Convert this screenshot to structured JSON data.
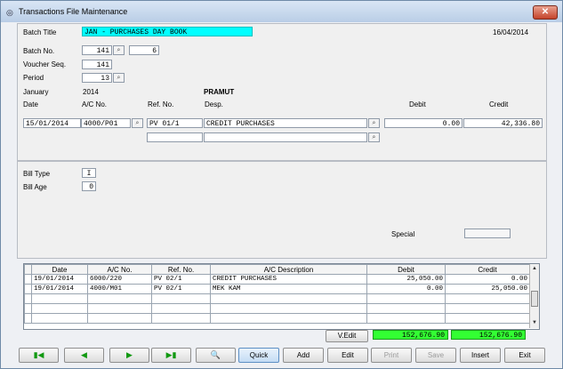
{
  "window": {
    "title": "Transactions File Maintenance",
    "close_label": "✕"
  },
  "header": {
    "batch_title_label": "Batch Title",
    "batch_title_value": "JAN - PURCHASES DAY BOOK",
    "date": "16/04/2014",
    "batch_no_label": "Batch No.",
    "batch_no_value": "141",
    "batch_no_extra": "6",
    "voucher_seq_label": "Voucher Seq.",
    "voucher_seq_value": "141",
    "period_label": "Period",
    "period_value": "13",
    "month": "January",
    "year": "2014",
    "account_name": "PRAMUT"
  },
  "entry": {
    "headers": {
      "date": "Date",
      "ac_no": "A/C No.",
      "ref_no": "Ref. No.",
      "desc": "Desp.",
      "debit": "Debit",
      "credit": "Credit"
    },
    "date": "15/01/2014",
    "ac_no": "4000/P01",
    "ref_no": "PV 01/1",
    "desc": "CREDIT PURCHASES",
    "debit": "0.00",
    "credit": "42,336.80"
  },
  "bill": {
    "type_label": "Bill Type",
    "type_value": "I",
    "age_label": "Bill Age",
    "age_value": "0",
    "special_label": "Special"
  },
  "grid": {
    "headers": [
      "Date",
      "A/C No.",
      "Ref. No.",
      "A/C Description",
      "Debit",
      "Credit"
    ],
    "rows": [
      [
        "19/01/2014",
        "6000/220",
        "PV 02/1",
        "CREDIT PURCHASES",
        "25,050.00",
        "0.00"
      ],
      [
        "19/01/2014",
        "4000/M01",
        "PV 02/1",
        "MEK KAM",
        "0.00",
        "25,050.00"
      ]
    ]
  },
  "totals": {
    "vedit_label": "V.Edit",
    "debit": "152,676.90",
    "credit": "152,676.90"
  },
  "toolbar": {
    "first": "▮◀",
    "prev": "◀",
    "next": "▶",
    "last": "▶▮",
    "search": "🔍",
    "quick": "Quick",
    "add": "Add",
    "edit": "Edit",
    "print": "Print",
    "save": "Save",
    "insert": "Insert",
    "exit": "Exit"
  },
  "colors": {
    "batch_title_bg": "#00ffff",
    "totals_bg": "#33ff33"
  },
  "icons": {
    "lookup": "lookup-icon"
  }
}
